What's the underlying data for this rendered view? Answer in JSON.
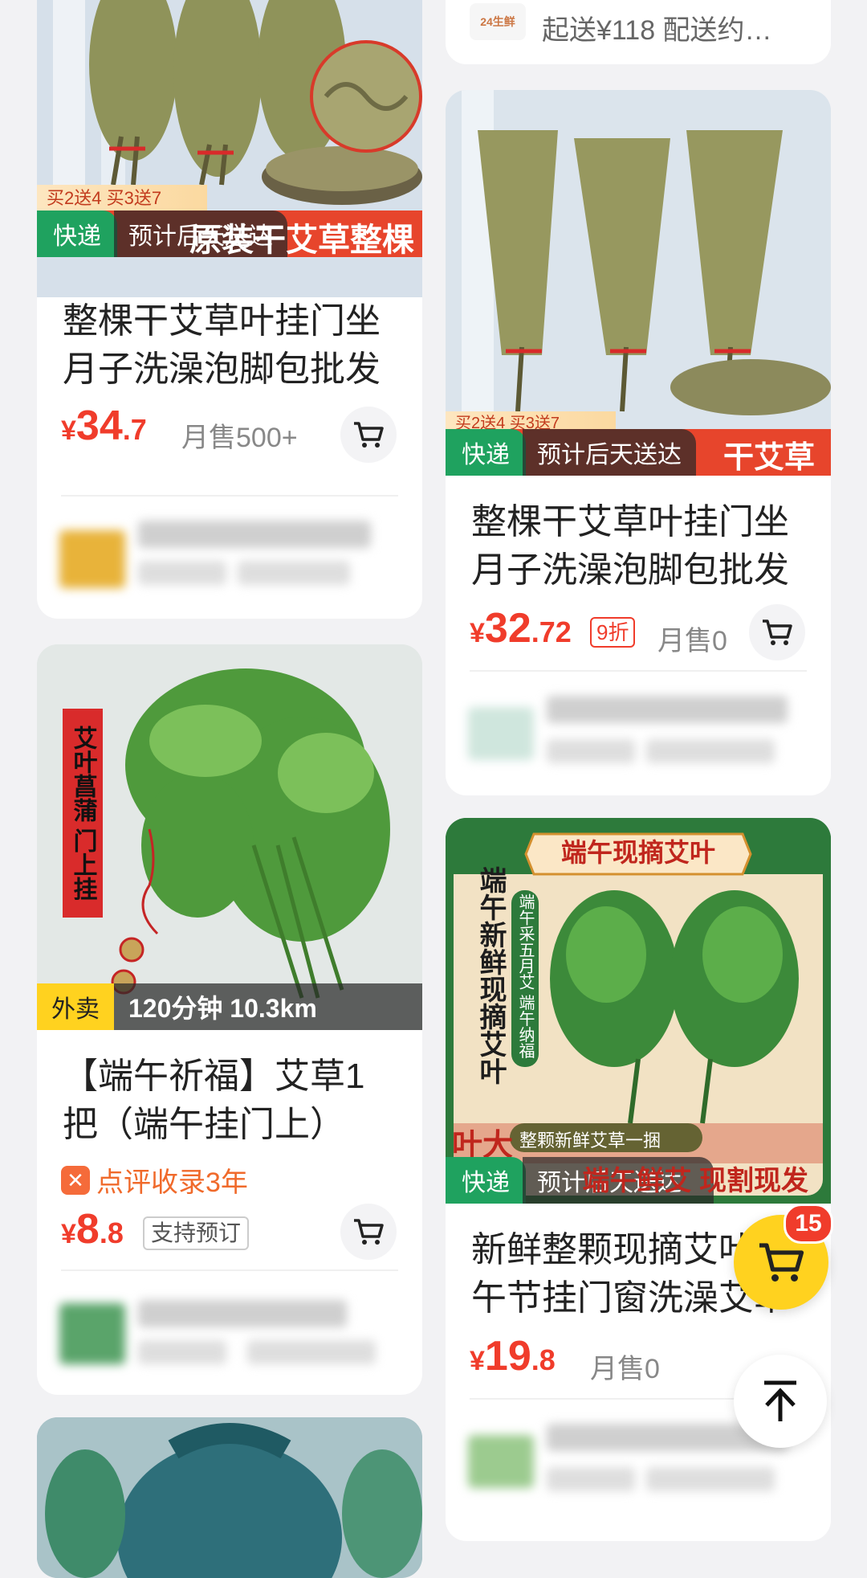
{
  "left_col": [
    {
      "promo_text": "买2送4 买3送7",
      "overlay_text": "原装干艾草整棵",
      "delivery_tag": "快递",
      "delivery_info": "预计后天送达",
      "title": "整棵干艾草叶挂门坐月子洗澡泡脚包批发",
      "price_currency": "¥",
      "price_int": "34",
      "price_dec": ".7",
      "sales": "月售500+"
    },
    {
      "side_banner": "艾叶菖蒲 门上挂",
      "delivery_tag": "外卖",
      "delivery_info": "120分钟 10.3km",
      "title": "【端午祈福】艾草1把（端午挂门上）",
      "review_badge": "点评收录3年",
      "price_currency": "¥",
      "price_int": "8",
      "price_dec": ".8",
      "preorder": "支持预订"
    },
    {
      "partial": true
    }
  ],
  "right_col": [
    {
      "store_logo_text": "24生鲜",
      "delivery_line": "起送¥118  配送约…"
    },
    {
      "promo_text": "买2送4 买3送7",
      "overlay_text": "干艾草",
      "delivery_tag": "快递",
      "delivery_info": "预计后天送达",
      "title": "整棵干艾草叶挂门坐月子洗澡泡脚包批发",
      "price_currency": "¥",
      "price_int": "32",
      "price_dec": ".72",
      "discount": "9折",
      "sales": "月售0"
    },
    {
      "banner_top": "端午现摘艾叶",
      "banner_vertical": "端午新鲜现摘艾叶",
      "banner_vertical_small": "端午采五月艾 端午纳福",
      "banner_bottom": "整颗新鲜艾草一捆",
      "banner_corner": "叶大",
      "overlay_text": "端午鲜艾 现割现发",
      "delivery_tag": "快递",
      "delivery_info": "预计后天送达",
      "title": "新鲜整颗现摘艾叶端午节挂门窗洗澡艾草",
      "price_currency": "¥",
      "price_int": "19",
      "price_dec": ".8",
      "sales": "月售0"
    }
  ],
  "floating_cart": {
    "count": "15"
  },
  "colors": {
    "price": "#f03c2b",
    "green_tag": "#1fa25f",
    "cart_yellow": "#ffd21f"
  }
}
